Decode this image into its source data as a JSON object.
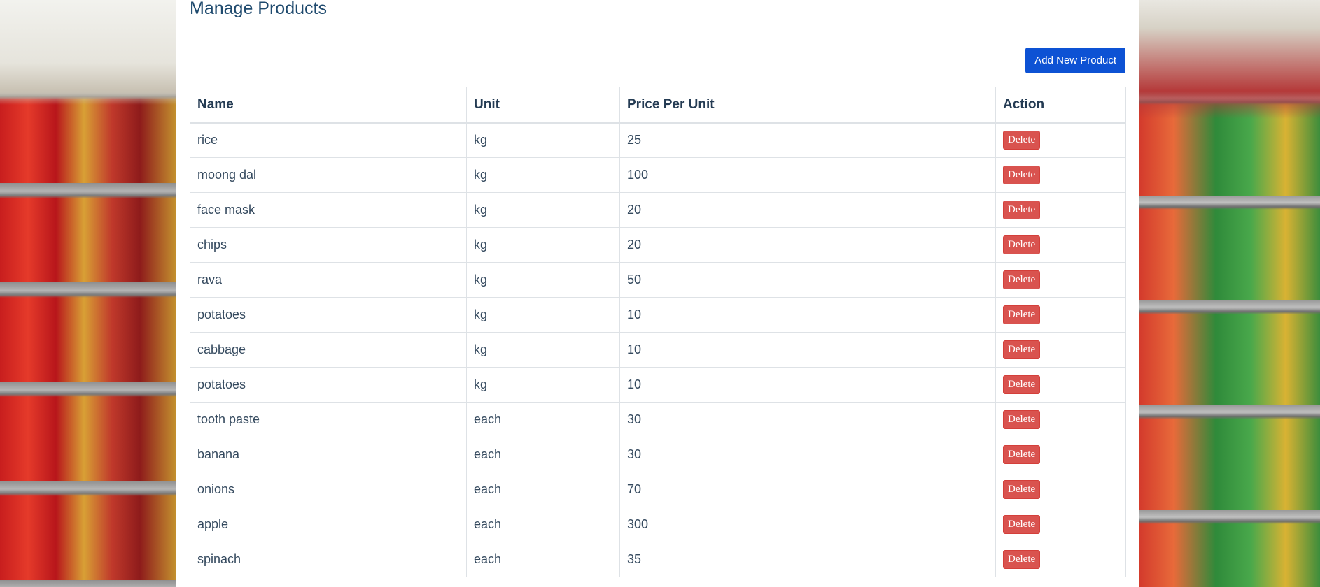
{
  "page": {
    "title": "Manage Products"
  },
  "toolbar": {
    "add_label": "Add New Product"
  },
  "table": {
    "headers": {
      "name": "Name",
      "unit": "Unit",
      "price": "Price Per Unit",
      "action": "Action"
    },
    "delete_label": "Delete",
    "rows": [
      {
        "name": "rice",
        "unit": "kg",
        "price": "25"
      },
      {
        "name": "moong dal",
        "unit": "kg",
        "price": "100"
      },
      {
        "name": "face mask",
        "unit": "kg",
        "price": "20"
      },
      {
        "name": "chips",
        "unit": "kg",
        "price": "20"
      },
      {
        "name": "rava",
        "unit": "kg",
        "price": "50"
      },
      {
        "name": "potatoes",
        "unit": "kg",
        "price": "10"
      },
      {
        "name": "cabbage",
        "unit": "kg",
        "price": "10"
      },
      {
        "name": "potatoes",
        "unit": "kg",
        "price": "10"
      },
      {
        "name": "tooth paste",
        "unit": "each",
        "price": "30"
      },
      {
        "name": "banana",
        "unit": "each",
        "price": "30"
      },
      {
        "name": "onions",
        "unit": "each",
        "price": "70"
      },
      {
        "name": "apple",
        "unit": "each",
        "price": "300"
      },
      {
        "name": "spinach",
        "unit": "each",
        "price": "35"
      }
    ]
  },
  "colors": {
    "primary_button": "#0d52d4",
    "danger_button": "#d9534f",
    "title": "#1f4a6e"
  }
}
